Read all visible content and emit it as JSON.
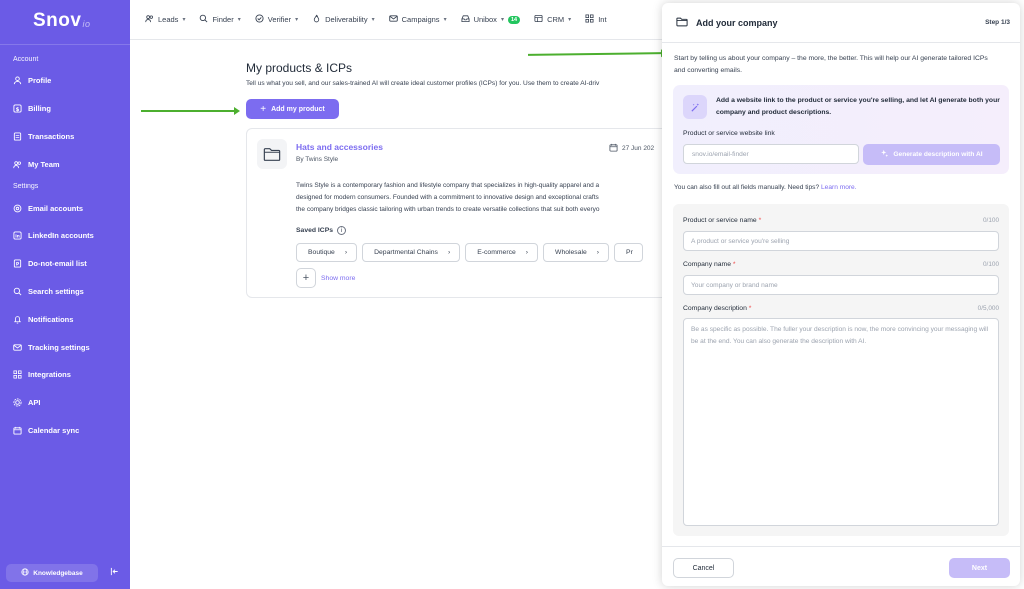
{
  "colors": {
    "sidebar": "#6b5be6",
    "accent": "#7c6cf0",
    "accent_disabled": "#c6bcf8",
    "badge": "#22c55e",
    "arrow": "#4caf2f"
  },
  "sidebar": {
    "logo": "Snov",
    "logo_suffix": "io",
    "sections": [
      {
        "title": "Account",
        "items": [
          {
            "label": "Profile",
            "icon": "user-icon"
          },
          {
            "label": "Billing",
            "icon": "dollar-icon"
          },
          {
            "label": "Transactions",
            "icon": "receipt-icon"
          },
          {
            "label": "My Team",
            "icon": "team-icon"
          }
        ]
      },
      {
        "title": "Settings",
        "items": [
          {
            "label": "Email accounts",
            "icon": "email-accounts-icon"
          },
          {
            "label": "LinkedIn accounts",
            "icon": "linkedin-icon"
          },
          {
            "label": "Do-not-email list",
            "icon": "do-not-email-icon"
          },
          {
            "label": "Search settings",
            "icon": "search-icon"
          },
          {
            "label": "Notifications",
            "icon": "bell-icon"
          },
          {
            "label": "Tracking settings",
            "icon": "mail-tracking-icon"
          },
          {
            "label": "Integrations",
            "icon": "grid-icon"
          },
          {
            "label": "API",
            "icon": "api-icon"
          },
          {
            "label": "Calendar sync",
            "icon": "calendar-icon"
          }
        ]
      }
    ],
    "knowledgebase": "Knowledgebase"
  },
  "topnav": {
    "items": [
      {
        "label": "Leads",
        "icon": "leads-icon"
      },
      {
        "label": "Finder",
        "icon": "search-icon"
      },
      {
        "label": "Verifier",
        "icon": "check-circle-icon"
      },
      {
        "label": "Deliverability",
        "icon": "flame-icon"
      },
      {
        "label": "Campaigns",
        "icon": "envelope-icon"
      },
      {
        "label": "Unibox",
        "icon": "inbox-icon",
        "badge": "14"
      },
      {
        "label": "CRM",
        "icon": "crm-icon"
      },
      {
        "label": "Int",
        "icon": "integrations-icon"
      }
    ]
  },
  "main": {
    "title": "My products & ICPs",
    "subtitle": "Tell us what you sell, and our sales-trained AI will create ideal customer profiles (ICPs) for you. Use them to create AI-driv",
    "add_button": "Add my product",
    "product": {
      "name": "Hats and accessories",
      "by": "By Twins Style",
      "date": "27 Jun 202",
      "description_lines": [
        "Twins Style is a contemporary fashion and lifestyle company that specializes in high-quality apparel and a",
        "designed for modern consumers. Founded with a commitment to innovative design and exceptional crafts",
        "the company bridges classic tailoring with urban trends to create versatile collections that suit both everyo"
      ],
      "saved_icps_label": "Saved ICPs",
      "icps": [
        "Boutique",
        "Departmental Chains",
        "E-commerce",
        "Wholesale",
        "Pr"
      ],
      "show_more": "Show more"
    }
  },
  "panel": {
    "title": "Add your company",
    "step": "Step 1/3",
    "intro": "Start by telling us about your company – the more, the better. This will help our AI generate tailored ICPs and converting emails.",
    "ai_text": "Add a website link to the product or service you're selling, and let AI generate both your company and product descriptions.",
    "url_label": "Product or service website link",
    "url_placeholder": "snov.io/email-finder",
    "generate_button": "Generate description with AI",
    "manual_tip": "You can also fill out all fields manually. Need tips?",
    "learn_more": "Learn more.",
    "fields": {
      "product_name": {
        "label": "Product or service name",
        "count": "0/100",
        "placeholder": "A product or service you're selling"
      },
      "company_name": {
        "label": "Company name",
        "count": "0/100",
        "placeholder": "Your company or brand name"
      },
      "company_description": {
        "label": "Company description",
        "count": "0/5,000",
        "placeholder": "Be as specific as possible. The fuller your description is now, the more convincing your messaging will be at the end. You can also generate the description with AI."
      }
    },
    "required_mark": "*",
    "cancel": "Cancel",
    "next": "Next"
  }
}
